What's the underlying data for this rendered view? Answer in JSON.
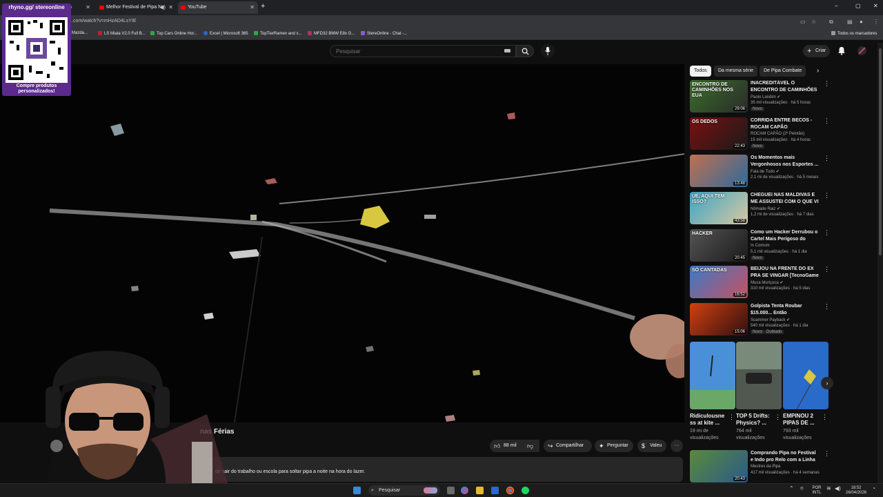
{
  "browser": {
    "tabs": [
      {
        "label": "h",
        "active": false
      },
      {
        "label": "Melhor Festival de Pipa No",
        "active": false
      },
      {
        "label": "YouTube",
        "active": true
      }
    ],
    "url": ".com/watch?v=mHzAD4LsYIE",
    "bookmarks": [
      "Mazda...",
      "LS Miata V2.0 Full B...",
      "Top Cars Online Hor...",
      "Excel | Microsoft 365",
      "TopTierRamen and s...",
      "MFD32 BMW E8x G...",
      "StereOnline - Chat -..."
    ],
    "all_bookmarks": "Todos os marcadores"
  },
  "header": {
    "search_placeholder": "Pesquisar",
    "create_label": "Criar"
  },
  "video": {
    "title_visible": "nas Férias",
    "likes": "88 mil",
    "share_label": "Compartilhar",
    "ask_label": "Perguntar",
    "thanks_label": "Valeu",
    "description": "de sair do trabalho ou escola para soltar pipa a noite na hora do lazer."
  },
  "chips": [
    "Todos",
    "Da mesma série",
    "De Pipa Combate"
  ],
  "recommendations": [
    {
      "title": "INACREDITÁVEL O ENCONTRO DE CAMINHÕES NOS ESTADO...",
      "channel": "Paolo Landim",
      "verified": true,
      "meta": "35 mil visualizações · há 5 horas",
      "badge": "Novo",
      "duration": "29:06",
      "thumb_text": "ENCONTRO DE CAMINHÕES NOS EUA",
      "colors": [
        "#3a6f2a",
        "#2a2a2a"
      ]
    },
    {
      "title": "CORRIDA ENTRE BECOS - ROCAM CAPÃO",
      "channel": "ROCAM CAPÃO (2º Pelotão)",
      "verified": false,
      "meta": "15 mil visualizações · há 4 horas",
      "badge": "Novo",
      "duration": "22:43",
      "thumb_text": "OS DEDOS",
      "colors": [
        "#7a1010",
        "#1a1a1a"
      ]
    },
    {
      "title": "Os Momentos mais Vergonhosos nos Esportes ...",
      "channel": "Fala de Tudo",
      "verified": true,
      "meta": "2,1 mi de visualizações · há 5 meses",
      "badge": "",
      "duration": "13:48",
      "thumb_text": "",
      "colors": [
        "#c07050",
        "#2c6a9c"
      ]
    },
    {
      "title": "CHEGUEI NAS MALDIVAS E ME ASSUSTEI COM O QUE VI",
      "channel": "Nômade Raiz",
      "verified": true,
      "meta": "1,2 mi de visualizações · há 7 dias",
      "badge": "",
      "duration": "43:58",
      "thumb_text": "UÉ, AQUI TEM ISSO?",
      "colors": [
        "#3aa6c8",
        "#d8c8a0"
      ]
    },
    {
      "title": "Como um Hacker Derrubou o Cartel Mais Perigoso do Mundo",
      "channel": "In Comum",
      "verified": false,
      "meta": "5,1 mil visualizações · há 1 dia",
      "badge": "Novo",
      "duration": "20:45",
      "thumb_text": "HACKER",
      "colors": [
        "#555555",
        "#1a1a1a"
      ]
    },
    {
      "title": "BEIJOU NA FRENTE DO EX PRA SE VINGAR [TecnoGame - Port...",
      "channel": "Muca Muriçoca",
      "verified": true,
      "meta": "310 mil visualizações · há 5 dias",
      "badge": "",
      "duration": "16:52",
      "thumb_text": "SÓ CANTADAS",
      "colors": [
        "#3a7ac8",
        "#c85060"
      ]
    },
    {
      "title": "Golpista Tenta Roubar $15.000... Então DERRETEMO...",
      "channel": "Scammer Payback",
      "verified": true,
      "meta": "540 mil visualizações · há 1 dia",
      "badge": "Novo",
      "badge2": "Dublado",
      "duration": "15:06",
      "thumb_text": "",
      "colors": [
        "#d04010",
        "#301010"
      ]
    }
  ],
  "shorts": [
    {
      "title": "Ridiculousne ss at kite ...",
      "views": "19 mi de visualizações",
      "colors": [
        "#4a90d8",
        "#7ab8e8"
      ]
    },
    {
      "title": "TOP 5 Drifts: Physics? ...",
      "views": "764 mil visualizações",
      "colors": [
        "#6a7a6a",
        "#3a4a3a"
      ]
    },
    {
      "title": "EMPINOU 2 PIPAS DE ...",
      "views": "793 mil visualizações",
      "colors": [
        "#2a6ac8",
        "#6aa8e8"
      ]
    }
  ],
  "last_rec": {
    "title": "Comprando Pipa no Festival e Indo pro Relo com a Linha ...",
    "channel": "Mestres da Pipa",
    "meta": "417 mil visualizações · há 4 semanas",
    "duration": "20:43",
    "colors": [
      "#5a8a3a",
      "#2a5a8a"
    ]
  },
  "overlay": {
    "qr_title": "rhyno.gg/ stereonline",
    "qr_caption": "Compre produtos personalizados!"
  },
  "taskbar": {
    "search_label": "Pesquisar",
    "lang_top": "POR",
    "lang_bottom": "INTL",
    "time": "18:52",
    "date": "26/04/2026"
  }
}
